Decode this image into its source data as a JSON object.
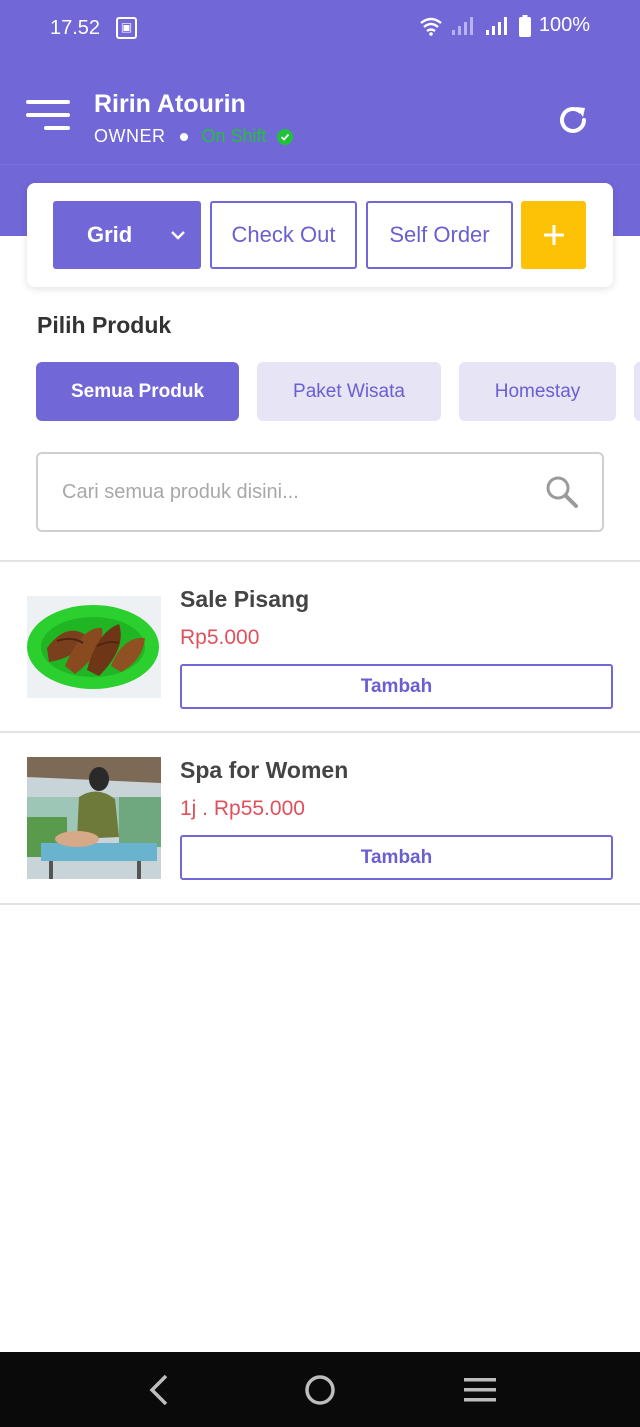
{
  "status_bar": {
    "time": "17.52",
    "notification_icon": "gallery-notification-icon",
    "wifi_icon": "wifi-icon",
    "signal_icon": "cell-signal-icon",
    "battery_icon": "battery-icon",
    "battery_text": "100%"
  },
  "header": {
    "menu_icon": "hamburger-menu-icon",
    "user_name": "Ririn Atourin",
    "role": "OWNER",
    "shift_status": "On Shift",
    "refresh_icon": "refresh-icon"
  },
  "toolbar": {
    "grid_label": "Grid",
    "checkout_label": "Check Out",
    "self_order_label": "Self Order",
    "add_icon": "plus-icon"
  },
  "section_title": "Pilih Produk",
  "categories": [
    {
      "label": "Semua Produk",
      "active": true
    },
    {
      "label": "Paket Wisata",
      "active": false
    },
    {
      "label": "Homestay",
      "active": false
    }
  ],
  "search": {
    "placeholder": "Cari semua produk disini...",
    "value": ""
  },
  "products": [
    {
      "name": "Sale Pisang",
      "price": "Rp5.000",
      "button_label": "Tambah"
    },
    {
      "name": "Spa for Women",
      "price": "1j . Rp55.000",
      "button_label": "Tambah"
    }
  ],
  "colors": {
    "primary": "#7267d7",
    "accent_yellow": "#fdc106",
    "price_red": "#e0505c",
    "shift_green": "#20c23a"
  }
}
